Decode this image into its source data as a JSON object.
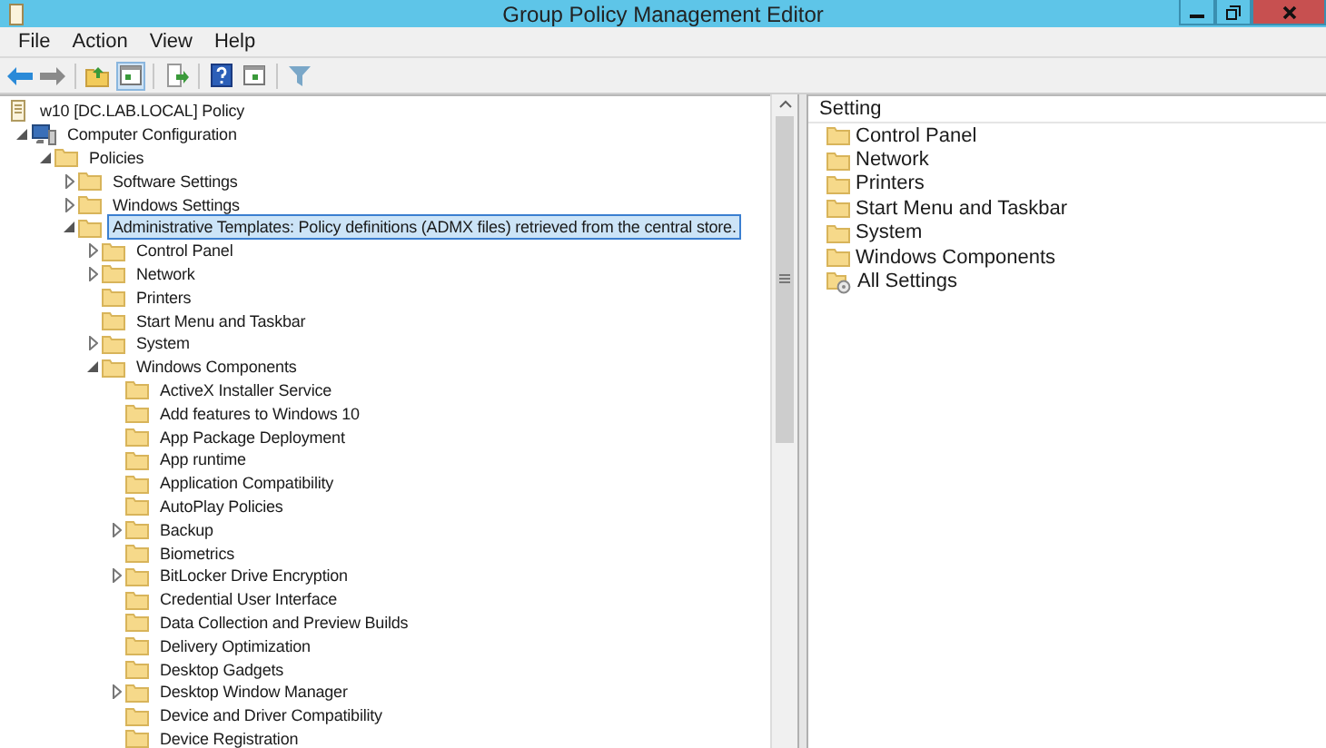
{
  "window": {
    "title": "Group Policy Management Editor"
  },
  "menu": [
    "File",
    "Action",
    "View",
    "Help"
  ],
  "tree": [
    {
      "label": "w10 [DC.LAB.LOCAL] Policy",
      "kind": "policy",
      "selected": false,
      "children": [
        {
          "label": "Computer Configuration",
          "kind": "computer",
          "expanded": true,
          "selected": false,
          "children": [
            {
              "label": "Policies",
              "kind": "folder",
              "expanded": true,
              "selected": false,
              "children": [
                {
                  "label": "Software Settings",
                  "kind": "folder",
                  "expanded": false,
                  "selected": false
                },
                {
                  "label": "Windows Settings",
                  "kind": "folder",
                  "expanded": false,
                  "selected": false
                },
                {
                  "label": "Administrative Templates: Policy definitions (ADMX files) retrieved from the central store.",
                  "kind": "folder",
                  "expanded": true,
                  "selected": true,
                  "children": [
                    {
                      "label": "Control Panel",
                      "kind": "folder",
                      "expanded": false,
                      "selected": false
                    },
                    {
                      "label": "Network",
                      "kind": "folder",
                      "expanded": false,
                      "selected": false
                    },
                    {
                      "label": "Printers",
                      "kind": "folder",
                      "selected": false
                    },
                    {
                      "label": "Start Menu and Taskbar",
                      "kind": "folder",
                      "selected": false
                    },
                    {
                      "label": "System",
                      "kind": "folder",
                      "expanded": false,
                      "selected": false
                    },
                    {
                      "label": "Windows Components",
                      "kind": "folder",
                      "expanded": true,
                      "selected": false,
                      "children": [
                        {
                          "label": "ActiveX Installer Service",
                          "kind": "folder",
                          "selected": false
                        },
                        {
                          "label": "Add features to Windows 10",
                          "kind": "folder",
                          "selected": false
                        },
                        {
                          "label": "App Package Deployment",
                          "kind": "folder",
                          "selected": false
                        },
                        {
                          "label": "App runtime",
                          "kind": "folder",
                          "selected": false
                        },
                        {
                          "label": "Application Compatibility",
                          "kind": "folder",
                          "selected": false
                        },
                        {
                          "label": "AutoPlay Policies",
                          "kind": "folder",
                          "selected": false
                        },
                        {
                          "label": "Backup",
                          "kind": "folder",
                          "expanded": false,
                          "selected": false
                        },
                        {
                          "label": "Biometrics",
                          "kind": "folder",
                          "selected": false
                        },
                        {
                          "label": "BitLocker Drive Encryption",
                          "kind": "folder",
                          "expanded": false,
                          "selected": false
                        },
                        {
                          "label": "Credential User Interface",
                          "kind": "folder",
                          "selected": false
                        },
                        {
                          "label": "Data Collection and Preview Builds",
                          "kind": "folder",
                          "selected": false
                        },
                        {
                          "label": "Delivery Optimization",
                          "kind": "folder",
                          "selected": false
                        },
                        {
                          "label": "Desktop Gadgets",
                          "kind": "folder",
                          "selected": false
                        },
                        {
                          "label": "Desktop Window Manager",
                          "kind": "folder",
                          "expanded": false,
                          "selected": false
                        },
                        {
                          "label": "Device and Driver Compatibility",
                          "kind": "folder",
                          "selected": false
                        },
                        {
                          "label": "Device Registration",
                          "kind": "folder",
                          "selected": false
                        }
                      ]
                    }
                  ]
                }
              ]
            }
          ]
        }
      ]
    }
  ],
  "details": {
    "column": "Setting",
    "items": [
      {
        "label": "Control Panel",
        "kind": "folder"
      },
      {
        "label": "Network",
        "kind": "folder"
      },
      {
        "label": "Printers",
        "kind": "folder"
      },
      {
        "label": "Start Menu and Taskbar",
        "kind": "folder"
      },
      {
        "label": "System",
        "kind": "folder"
      },
      {
        "label": "Windows Components",
        "kind": "folder"
      },
      {
        "label": "All Settings",
        "kind": "settings"
      }
    ]
  }
}
